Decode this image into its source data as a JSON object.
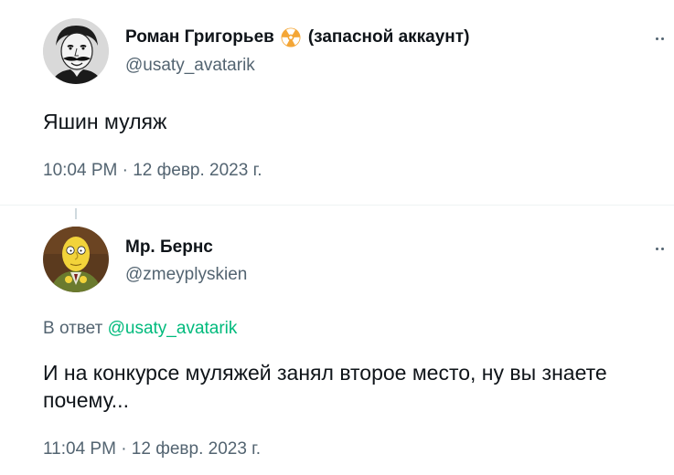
{
  "tweets": [
    {
      "author": {
        "name": "Роман Григорьев",
        "badge_icon": "radioactive-icon",
        "name_suffix": "(запасной аккаунт)",
        "handle": "@usaty_avatarik",
        "avatar": "avatar-mustache-man"
      },
      "text": "Яшин муляж",
      "timestamp": "10:04 PM · 12 февр. 2023 г.",
      "more_icon": "more-icon"
    },
    {
      "author": {
        "name": "Мр. Бернс",
        "handle": "@zmeyplyskien",
        "avatar": "avatar-mr-burns"
      },
      "reply_prefix": "В ответ",
      "reply_mention": "@usaty_avatarik",
      "text": "И на конкурсе муляжей занял второе место, ну вы знаете почему...",
      "timestamp": "11:04 PM · 12 февр. 2023 г.",
      "more_icon": "more-icon"
    }
  ],
  "colors": {
    "text": "#0f1419",
    "secondary": "#536471",
    "mention": "#00ba7c",
    "badge": "#f4a636",
    "divider": "#eff3f4"
  }
}
